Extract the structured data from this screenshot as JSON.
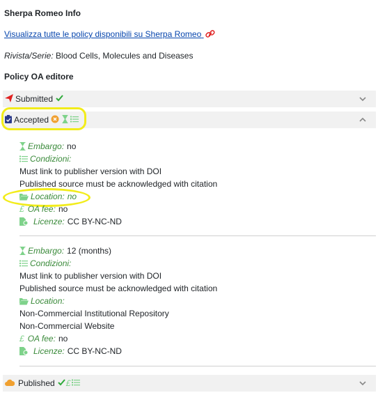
{
  "header": {
    "title": "Sherpa Romeo Info",
    "link_text": "Visualizza tutte le policy disponibili su Sherpa Romeo",
    "rivista_label": "Rivista/Serie:",
    "rivista_value": "Blood Cells, Molecules and Diseases",
    "policy_title": "Policy OA editore"
  },
  "sections": {
    "submitted": {
      "label": "Submitted",
      "icon": "paper-plane-icon",
      "color": "#e02020"
    },
    "accepted": {
      "label": "Accepted",
      "icon": "clipboard-check-icon",
      "badge_icon": "x-circle-icon",
      "badge_color": "#f0a030"
    },
    "published": {
      "label": "Published",
      "icon": "cloud-icon",
      "color": "#f0a030"
    }
  },
  "labels": {
    "embargo": "Embargo:",
    "condizioni": "Condizioni:",
    "location": "Location:",
    "oa_fee": "OA fee:",
    "licenze": "Licenze:"
  },
  "accepted_policies": [
    {
      "embargo": "no",
      "conditions": [
        "Must link to publisher version with DOI",
        "Published source must be acknowledged with citation"
      ],
      "location": "no",
      "oa_fee": "no",
      "license": "CC BY-NC-ND"
    },
    {
      "embargo": "12 (months)",
      "conditions": [
        "Must link to publisher version with DOI",
        "Published source must be acknowledged with citation"
      ],
      "locations": [
        "Non-Commercial Institutional Repository",
        "Non-Commercial Website"
      ],
      "oa_fee": "no",
      "license": "CC BY-NC-ND"
    }
  ],
  "colors": {
    "link": "#0645ad",
    "field_label": "#3a8a3a",
    "highlight": "#f2ec1a",
    "header_bg": "#f1f1f1"
  }
}
